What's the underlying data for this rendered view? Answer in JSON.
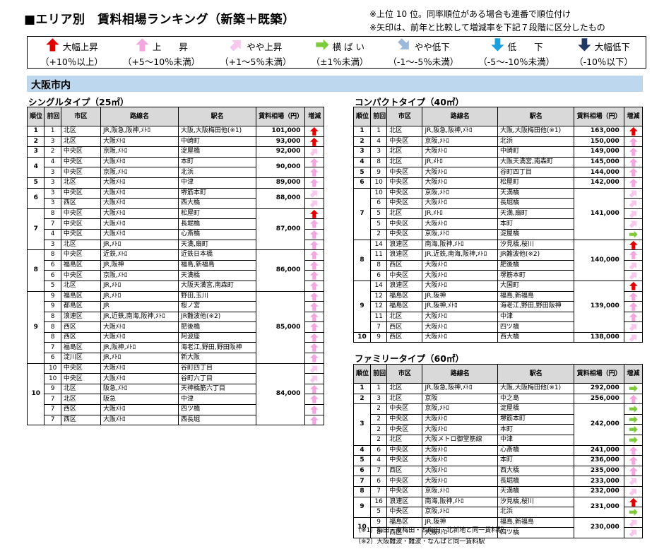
{
  "title": "■エリア別　賃料相場ランキング（新築＋既築）",
  "notes": [
    "※上位 10 位。同率順位がある場合も連番で順位付け",
    "※矢印は、前年と比較して増減率を下記７段階に区分したもの"
  ],
  "legend": [
    {
      "label": "大幅上昇",
      "range": "（+10％以上）",
      "icon": "up-big",
      "color": "#e00000"
    },
    {
      "label": "上　　昇",
      "range": "（+5～10％未満）",
      "icon": "up",
      "color": "#f4a6df"
    },
    {
      "label": "やや上昇",
      "range": "（+1～5％未満）",
      "icon": "up-slight",
      "color": "#f8c7ec"
    },
    {
      "label": "横 ば い",
      "range": "（±1％未満）",
      "icon": "flat",
      "color": "#7ccc3a"
    },
    {
      "label": "やや低下",
      "range": "（-1～-5％未満）",
      "icon": "down-slight",
      "color": "#9db9d9"
    },
    {
      "label": "低　　下",
      "range": "（-5～-10％未満）",
      "icon": "down",
      "color": "#1aa0dc"
    },
    {
      "label": "大幅低下",
      "range": "（-10％以下）",
      "icon": "down-big",
      "color": "#1f3864"
    }
  ],
  "area": "大阪市内",
  "headers": [
    "順位",
    "前回",
    "市区",
    "路線名",
    "駅名",
    "賃料相場（円）",
    "増減"
  ],
  "tables": [
    {
      "title": "シングルタイプ（25㎡）",
      "rows": [
        {
          "rank": "1",
          "prev": "1",
          "ward": "北区",
          "line": "JR,阪急,阪神,ﾒﾄﾛ",
          "station": "大阪,大阪梅田他(※1)",
          "rent": "101,000",
          "arrow": "up-big"
        },
        {
          "rank": "2",
          "prev": "3",
          "ward": "北区",
          "line": "大阪ﾒﾄﾛ",
          "station": "中崎町",
          "rent": "93,000",
          "arrow": "up-big"
        },
        {
          "rank": "3",
          "prev": "2",
          "ward": "中央区",
          "line": "京阪,ﾒﾄﾛ",
          "station": "淀屋橋",
          "rent": "92,000",
          "arrow": "up-slight"
        },
        {
          "rank": "4",
          "prev": "4",
          "ward": "中央区",
          "line": "大阪ﾒﾄﾛ",
          "station": "本町",
          "rent": "90,000",
          "arrow": "up",
          "span": 2
        },
        {
          "prev": "3",
          "ward": "中央区",
          "line": "京阪,ﾒﾄﾛ",
          "station": "北浜",
          "arrow": "up"
        },
        {
          "rank": "5",
          "prev": "3",
          "ward": "北区",
          "line": "大阪ﾒﾄﾛ",
          "station": "中津",
          "rent": "89,000",
          "arrow": "up"
        },
        {
          "rank": "6",
          "prev": "3",
          "ward": "中央区",
          "line": "大阪ﾒﾄﾛ",
          "station": "堺筋本町",
          "rent": "88,000",
          "arrow": "up-slight",
          "span": 2
        },
        {
          "prev": "3",
          "ward": "西区",
          "line": "大阪ﾒﾄﾛ",
          "station": "西大橋",
          "arrow": "up-slight"
        },
        {
          "rank": "7",
          "prev": "8",
          "ward": "中央区",
          "line": "大阪ﾒﾄﾛ",
          "station": "松屋町",
          "rent": "87,000",
          "arrow": "up-big",
          "span": 4
        },
        {
          "prev": "7",
          "ward": "中央区",
          "line": "大阪ﾒﾄﾛ",
          "station": "長堀橋",
          "arrow": "up"
        },
        {
          "prev": "4",
          "ward": "中央区",
          "line": "大阪ﾒﾄﾛ",
          "station": "心斎橋",
          "arrow": "up"
        },
        {
          "prev": "3",
          "ward": "北区",
          "line": "JR,ﾒﾄﾛ",
          "station": "天満,扇町",
          "arrow": "up"
        },
        {
          "rank": "8",
          "prev": "8",
          "ward": "中央区",
          "line": "近鉄,ﾒﾄﾛ",
          "station": "近鉄日本橋",
          "rent": "86,000",
          "arrow": "up",
          "span": 4
        },
        {
          "prev": "6",
          "ward": "福島区",
          "line": "JR,阪神",
          "station": "福島,新福島",
          "arrow": "up"
        },
        {
          "prev": "6",
          "ward": "中央区",
          "line": "京阪,ﾒﾄﾛ",
          "station": "天満橋",
          "arrow": "up"
        },
        {
          "prev": "5",
          "ward": "北区",
          "line": "JR,ﾒﾄﾛ",
          "station": "大阪天満宮,南森町",
          "arrow": "up"
        },
        {
          "rank": "9",
          "prev": "9",
          "ward": "福島区",
          "line": "JR,ﾒﾄﾛ",
          "station": "野田,玉川",
          "rent": "85,000",
          "arrow": "up",
          "span": 7
        },
        {
          "prev": "9",
          "ward": "都島区",
          "line": "JR",
          "station": "桜ノ宮",
          "arrow": "up"
        },
        {
          "prev": "8",
          "ward": "浪速区",
          "line": "JR,近鉄,南海,阪神,ﾒﾄﾛ",
          "station": "JR難波他(※2)",
          "arrow": "up"
        },
        {
          "prev": "8",
          "ward": "西区",
          "line": "大阪ﾒﾄﾛ",
          "station": "肥後橋",
          "arrow": "up"
        },
        {
          "prev": "8",
          "ward": "西区",
          "line": "大阪ﾒﾄﾛ",
          "station": "阿波座",
          "arrow": "up"
        },
        {
          "prev": "7",
          "ward": "福島区",
          "line": "JR,阪神,ﾒﾄﾛ",
          "station": "海老江,野田,野田阪神",
          "arrow": "up"
        },
        {
          "prev": "6",
          "ward": "淀川区",
          "line": "JR,ﾒﾄﾛ",
          "station": "新大阪",
          "arrow": "up"
        },
        {
          "rank": "10",
          "prev": "10",
          "ward": "中央区",
          "line": "大阪ﾒﾄﾛ",
          "station": "谷町四丁目",
          "rent": "84,000",
          "arrow": "up-slight",
          "span": 7
        },
        {
          "prev": "10",
          "ward": "中央区",
          "line": "大阪ﾒﾄﾛ",
          "station": "谷町六丁目",
          "arrow": "up-slight"
        },
        {
          "prev": "9",
          "ward": "北区",
          "line": "阪急,ﾒﾄﾛ",
          "station": "天神橋筋六丁目",
          "arrow": "up"
        },
        {
          "prev": "7",
          "ward": "北区",
          "line": "阪急",
          "station": "中津",
          "arrow": "up"
        },
        {
          "prev": "7",
          "ward": "西区",
          "line": "大阪ﾒﾄﾛ",
          "station": "四ツ橋",
          "arrow": "up"
        },
        {
          "prev": "7",
          "ward": "西区",
          "line": "大阪ﾒﾄﾛ",
          "station": "西長堀",
          "arrow": "up"
        }
      ]
    },
    {
      "title": "コンパクトタイプ（40㎡）",
      "rows": [
        {
          "rank": "1",
          "prev": "1",
          "ward": "北区",
          "line": "JR,阪急,阪神,ﾒﾄﾛ",
          "station": "大阪,大阪梅田他(※1)",
          "rent": "163,000",
          "arrow": "up-big"
        },
        {
          "rank": "2",
          "prev": "4",
          "ward": "中央区",
          "line": "京阪,ﾒﾄﾛ",
          "station": "北浜",
          "rent": "150,000",
          "arrow": "up"
        },
        {
          "rank": "3",
          "prev": "3",
          "ward": "北区",
          "line": "大阪ﾒﾄﾛ",
          "station": "中崎町",
          "rent": "149,000",
          "arrow": "up"
        },
        {
          "rank": "4",
          "prev": "8",
          "ward": "北区",
          "line": "JR,ﾒﾄﾛ",
          "station": "大阪天満宮,南森町",
          "rent": "145,000",
          "arrow": "up"
        },
        {
          "rank": "5",
          "prev": "9",
          "ward": "中央区",
          "line": "大阪ﾒﾄﾛ",
          "station": "谷町四丁目",
          "rent": "144,000",
          "arrow": "up"
        },
        {
          "rank": "6",
          "prev": "10",
          "ward": "中央区",
          "line": "大阪ﾒﾄﾛ",
          "station": "松屋町",
          "rent": "142,000",
          "arrow": "up"
        },
        {
          "rank": "7",
          "prev": "10",
          "ward": "中央区",
          "line": "京阪,ﾒﾄﾛ",
          "station": "天満橋",
          "rent": "141,000",
          "arrow": "up-slight",
          "span": 5
        },
        {
          "prev": "6",
          "ward": "中央区",
          "line": "大阪ﾒﾄﾛ",
          "station": "長堀橋",
          "arrow": "up-slight"
        },
        {
          "prev": "5",
          "ward": "北区",
          "line": "JR,ﾒﾄﾛ",
          "station": "天満,扇町",
          "arrow": "up-slight"
        },
        {
          "prev": "5",
          "ward": "中央区",
          "line": "大阪ﾒﾄﾛ",
          "station": "本町",
          "arrow": "up-slight"
        },
        {
          "prev": "2",
          "ward": "中央区",
          "line": "京阪,ﾒﾄﾛ",
          "station": "淀屋橋",
          "arrow": "flat"
        },
        {
          "rank": "8",
          "prev": "14",
          "ward": "浪速区",
          "line": "南海,阪神,ﾒﾄﾛ",
          "station": "汐見橋,桜川",
          "rent": "140,000",
          "arrow": "up-big",
          "span": 4
        },
        {
          "prev": "11",
          "ward": "浪速区",
          "line": "JR,近鉄,南海,阪神,ﾒﾄﾛ",
          "station": "JR難波他(※2)",
          "arrow": "up"
        },
        {
          "prev": "8",
          "ward": "西区",
          "line": "大阪ﾒﾄﾛ",
          "station": "肥後橋",
          "arrow": "up-slight"
        },
        {
          "prev": "6",
          "ward": "中央区",
          "line": "大阪ﾒﾄﾛ",
          "station": "堺筋本町",
          "arrow": "up-slight"
        },
        {
          "rank": "9",
          "prev": "14",
          "ward": "浪速区",
          "line": "大阪ﾒﾄﾛ",
          "station": "大国町",
          "rent": "139,000",
          "arrow": "up-big",
          "span": 5
        },
        {
          "prev": "12",
          "ward": "福島区",
          "line": "JR,阪神",
          "station": "福島,新福島",
          "arrow": "up"
        },
        {
          "prev": "12",
          "ward": "福島区",
          "line": "JR,阪神,ﾒﾄﾛ",
          "station": "海老江,野田,野田阪神",
          "arrow": "up"
        },
        {
          "prev": "11",
          "ward": "北区",
          "line": "大阪ﾒﾄﾛ",
          "station": "中津",
          "arrow": "up"
        },
        {
          "prev": "7",
          "ward": "西区",
          "line": "大阪ﾒﾄﾛ",
          "station": "四ツ橋",
          "arrow": "up-slight"
        },
        {
          "rank": "10",
          "prev": "9",
          "ward": "西区",
          "line": "大阪ﾒﾄﾛ",
          "station": "西大橋",
          "rent": "138,000",
          "arrow": "up-slight"
        }
      ]
    },
    {
      "title": "ファミリータイプ（60㎡）",
      "rows": [
        {
          "rank": "1",
          "prev": "1",
          "ward": "北区",
          "line": "JR,阪急,阪神,ﾒﾄﾛ",
          "station": "大阪,大阪梅田他(※1)",
          "rent": "292,000",
          "arrow": "flat"
        },
        {
          "rank": "2",
          "prev": "3",
          "ward": "北区",
          "line": "京阪",
          "station": "中之島",
          "rent": "256,000",
          "arrow": "up"
        },
        {
          "rank": "3",
          "prev": "2",
          "ward": "中央区",
          "line": "京阪,ﾒﾄﾛ",
          "station": "淀屋橋",
          "rent": "242,000",
          "arrow": "flat",
          "span": 4
        },
        {
          "prev": "2",
          "ward": "中央区",
          "line": "大阪ﾒﾄﾛ",
          "station": "堺筋本町",
          "arrow": "flat"
        },
        {
          "prev": "2",
          "ward": "中央区",
          "line": "大阪ﾒﾄﾛ",
          "station": "本町",
          "arrow": "flat"
        },
        {
          "prev": "2",
          "ward": "北区",
          "line": "大阪メトロ御堂筋線",
          "station": "中津",
          "arrow": "flat"
        },
        {
          "rank": "4",
          "prev": "6",
          "ward": "中央区",
          "line": "大阪ﾒﾄﾛ",
          "station": "心斎橋",
          "rent": "241,000",
          "arrow": "up"
        },
        {
          "rank": "5",
          "prev": "4",
          "ward": "中央区",
          "line": "大阪ﾒﾄﾛ",
          "station": "本町",
          "rent": "236,000",
          "arrow": "up"
        },
        {
          "rank": "6",
          "prev": "7",
          "ward": "西区",
          "line": "大阪ﾒﾄﾛ",
          "station": "西大橋",
          "rent": "235,000",
          "arrow": "up"
        },
        {
          "rank": "7",
          "prev": "6",
          "ward": "中央区",
          "line": "大阪ﾒﾄﾛ",
          "station": "長堀橋",
          "rent": "233,000",
          "arrow": "up-slight"
        },
        {
          "rank": "8",
          "prev": "7",
          "ward": "中央区",
          "line": "京阪,ﾒﾄﾛ",
          "station": "天満橋",
          "rent": "232,000",
          "arrow": "up-slight"
        },
        {
          "rank": "9",
          "prev": "16",
          "ward": "浪速区",
          "line": "南海,阪神,ﾒﾄﾛ",
          "station": "汐見橋,桜川",
          "rent": "231,000",
          "arrow": "up-big",
          "span": 2
        },
        {
          "prev": "5",
          "ward": "中央区",
          "line": "京阪,ﾒﾄﾛ",
          "station": "北浜",
          "arrow": "flat"
        },
        {
          "rank": "10",
          "prev": "9",
          "ward": "福島区",
          "line": "JR,阪神",
          "station": "福島,新福島",
          "rent": "230,000",
          "arrow": "up-slight",
          "span": 2
        },
        {
          "prev": "8",
          "ward": "西区",
          "line": "大阪ﾒﾄﾛ",
          "station": "四ツ橋",
          "arrow": "up-slight"
        }
      ]
    }
  ],
  "footnotes": [
    "（※1）梅田・東梅田・西梅田・北新地と同一賃料駅",
    "（※2）大阪難波・難波・なんばと同一賃料駅"
  ]
}
